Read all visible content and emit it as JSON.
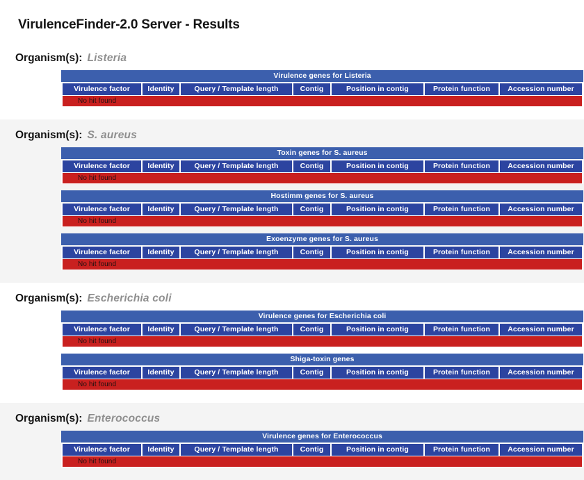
{
  "header": {
    "title": "VirulenceFinder-2.0 Server - Results"
  },
  "labels": {
    "organism_label": "Organism(s):",
    "no_hit": "No hit found"
  },
  "columns": [
    "Virulence factor",
    "Identity",
    "Query / Template length",
    "Contig",
    "Position in contig",
    "Protein function",
    "Accession number"
  ],
  "colors": {
    "caption_blue": "#3c5fad",
    "header_blue": "#2c44a0",
    "no_hit_red": "#c9201f",
    "section_shade": "#f4f4f4",
    "organism_name_gray": "#8f8f8f"
  },
  "sections": [
    {
      "organism": "Listeria",
      "shaded": false,
      "tables": [
        {
          "caption": "Virulence genes for Listeria",
          "rows": []
        }
      ]
    },
    {
      "organism": "S. aureus",
      "shaded": true,
      "tables": [
        {
          "caption": "Toxin genes for S. aureus",
          "rows": []
        },
        {
          "caption": "Hostimm genes for S. aureus",
          "rows": []
        },
        {
          "caption": "Exoenzyme genes for S. aureus",
          "rows": []
        }
      ]
    },
    {
      "organism": "Escherichia coli",
      "shaded": false,
      "tables": [
        {
          "caption": "Virulence genes for Escherichia coli",
          "rows": []
        },
        {
          "caption": "Shiga-toxin genes",
          "rows": []
        }
      ]
    },
    {
      "organism": "Enterococcus",
      "shaded": true,
      "tables": [
        {
          "caption": "Virulence genes for Enterococcus",
          "rows": []
        }
      ]
    }
  ]
}
